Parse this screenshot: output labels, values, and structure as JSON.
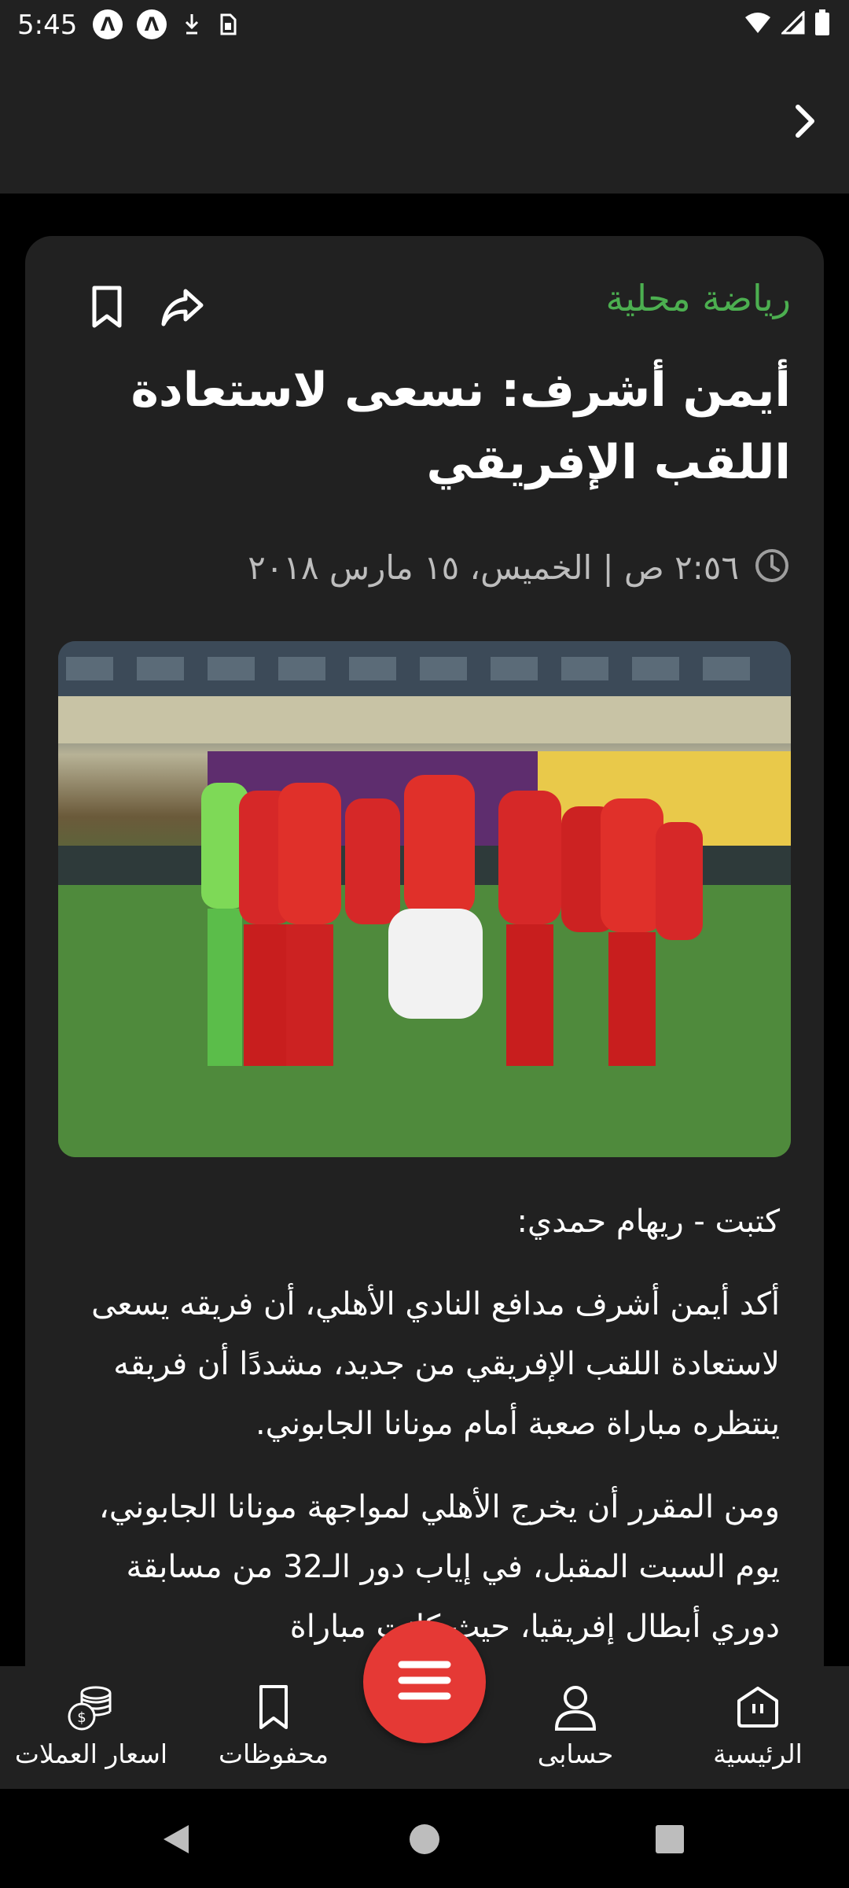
{
  "status_bar": {
    "time": "5:45",
    "left_icons": [
      "notification-a-icon",
      "notification-a-icon",
      "download-icon",
      "sim-icon"
    ],
    "right_icons": [
      "wifi-icon",
      "signal-icon",
      "battery-icon"
    ]
  },
  "app_bar": {
    "back_icon": "chevron-right-icon"
  },
  "article": {
    "category": "رياضة محلية",
    "title": "أيمن أشرف: نسعى لاستعادة اللقب الإفريقي",
    "date": "٢:٥٦ ص | الخميس، ١٥ مارس ٢٠١٨",
    "image_alt": "صورة لاعبي النادي الأهلي",
    "byline": "كتبت - ريهام حمدي:",
    "paragraphs": [
      "أكد أيمن أشرف مدافع النادي الأهلي، أن فريقه يسعى لاستعادة اللقب الإفريقي من جديد، مشددًا أن فريقه ينتظره مباراة صعبة أمام مونانا الجابوني.",
      "ومن المقرر أن يخرج الأهلي لمواجهة مونانا الجابوني، يوم السبت المقبل، في إياب دور الـ32 من مسابقة دوري أبطال إفريقيا، حيث كانت مباراة"
    ],
    "actions": {
      "bookmark_icon": "bookmark-icon",
      "share_icon": "share-icon"
    }
  },
  "bottom_nav": {
    "items": [
      {
        "label": "اسعار العملات",
        "icon": "coins-icon"
      },
      {
        "label": "محفوظات",
        "icon": "bookmark-icon"
      },
      {
        "label": "حسابى",
        "icon": "user-icon"
      },
      {
        "label": "الرئيسية",
        "icon": "home-icon"
      }
    ],
    "fab_icon": "menu-icon"
  },
  "colors": {
    "background": "#000000",
    "surface": "#212121",
    "category": "#4caf50",
    "fab": "#e53935",
    "muted_text": "#bdbdbd"
  }
}
